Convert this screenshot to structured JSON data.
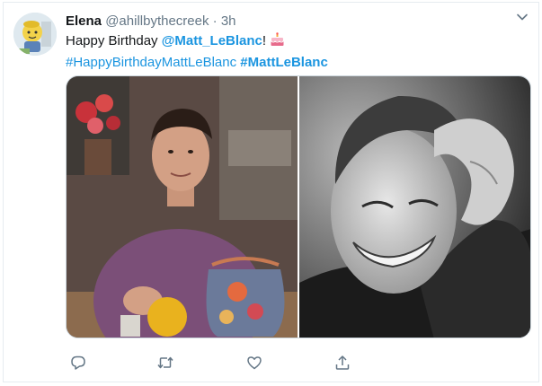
{
  "tweet": {
    "author_name": "Elena",
    "author_handle": "@ahillbythecreek",
    "separator": "·",
    "timestamp": "3h",
    "text": {
      "greeting": "Happy Birthday ",
      "mention": "@Matt_LeBlanc",
      "exclaim": "!",
      "hashtag_1": "#HappyBirthdayMattLeBlanc",
      "hashtag_2": "#MattLeBlanc"
    }
  },
  "icons": {
    "menu": "chevron-down-icon",
    "cake": "birthday-cake-icon",
    "reply": "reply-icon",
    "retweet": "retweet-icon",
    "like": "heart-icon",
    "share": "share-icon"
  },
  "colors": {
    "link": "#1b95e0",
    "name": "#14171a",
    "muted": "#657786",
    "border": "#e6ecf0"
  }
}
